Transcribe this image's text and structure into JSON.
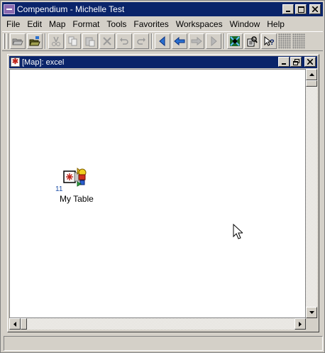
{
  "window": {
    "title": "Compendium - Michelle Test",
    "icon": "compendium-app-icon",
    "caption_buttons": [
      "minimize",
      "maximize",
      "close"
    ]
  },
  "menu": {
    "items": [
      "File",
      "Edit",
      "Map",
      "Format",
      "Tools",
      "Favorites",
      "Workspaces",
      "Window",
      "Help"
    ]
  },
  "toolbar": {
    "buttons": [
      {
        "name": "open-icon",
        "enabled": true
      },
      {
        "name": "open-project-icon",
        "enabled": true
      },
      {
        "name": "cut-icon",
        "enabled": false
      },
      {
        "name": "copy-icon",
        "enabled": false
      },
      {
        "name": "paste-icon",
        "enabled": false
      },
      {
        "name": "delete-icon",
        "enabled": false
      },
      {
        "name": "undo-icon",
        "enabled": false
      },
      {
        "name": "redo-icon",
        "enabled": false
      },
      {
        "name": "back-icon",
        "enabled": true
      },
      {
        "name": "back-history-icon",
        "enabled": true
      },
      {
        "name": "forward-history-icon",
        "enabled": false
      },
      {
        "name": "forward-icon",
        "enabled": false
      },
      {
        "name": "image-rollover-icon",
        "enabled": true
      },
      {
        "name": "search-icon",
        "enabled": true
      },
      {
        "name": "help-icon",
        "enabled": true
      }
    ]
  },
  "map_frame": {
    "title": "[Map]: excel",
    "icon": "map-node-icon",
    "caption_buttons": [
      "minimize",
      "restore",
      "close"
    ]
  },
  "node": {
    "count": "11",
    "label": "My Table",
    "icon": "reference-node-icon"
  },
  "colors": {
    "titlebar_active": "#0a246a",
    "chrome": "#d4d0c8",
    "canvas": "#ffffff",
    "node_count": "#1c4ea6"
  }
}
